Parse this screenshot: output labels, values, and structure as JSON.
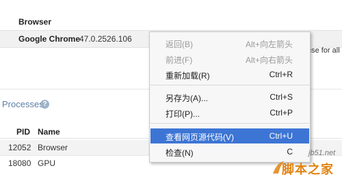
{
  "browser": {
    "heading": "Browser",
    "name": "Google Chrome",
    "version": "47.0.2526.106",
    "truncated_text": "use for all"
  },
  "processes": {
    "title": "Processes",
    "help_icon": "?",
    "columns": {
      "pid": "PID",
      "name": "Name"
    },
    "rows": [
      {
        "pid": "12052",
        "name": "Browser"
      },
      {
        "pid": "18080",
        "name": "GPU"
      }
    ]
  },
  "context_menu": {
    "items": [
      {
        "label": "返回(B)",
        "shortcut": "Alt+向左箭头",
        "disabled": true
      },
      {
        "label": "前进(F)",
        "shortcut": "Alt+向右箭头",
        "disabled": true
      },
      {
        "label": "重新加载(R)",
        "shortcut": "Ctrl+R"
      },
      {
        "label": "另存为(A)...",
        "shortcut": "Ctrl+S"
      },
      {
        "label": "打印(P)...",
        "shortcut": "Ctrl+P"
      },
      {
        "label": "查看网页源代码(V)",
        "shortcut": "Ctrl+U",
        "highlighted": true
      },
      {
        "label": "检查(N)",
        "shortcut": "C"
      }
    ]
  },
  "watermark": {
    "url": "jb51.net",
    "text": "脚本之家"
  },
  "colors": {
    "menu_highlight": "#3d75d4",
    "watermark_orange": "#e08412",
    "processes_title": "#5b7da8"
  }
}
